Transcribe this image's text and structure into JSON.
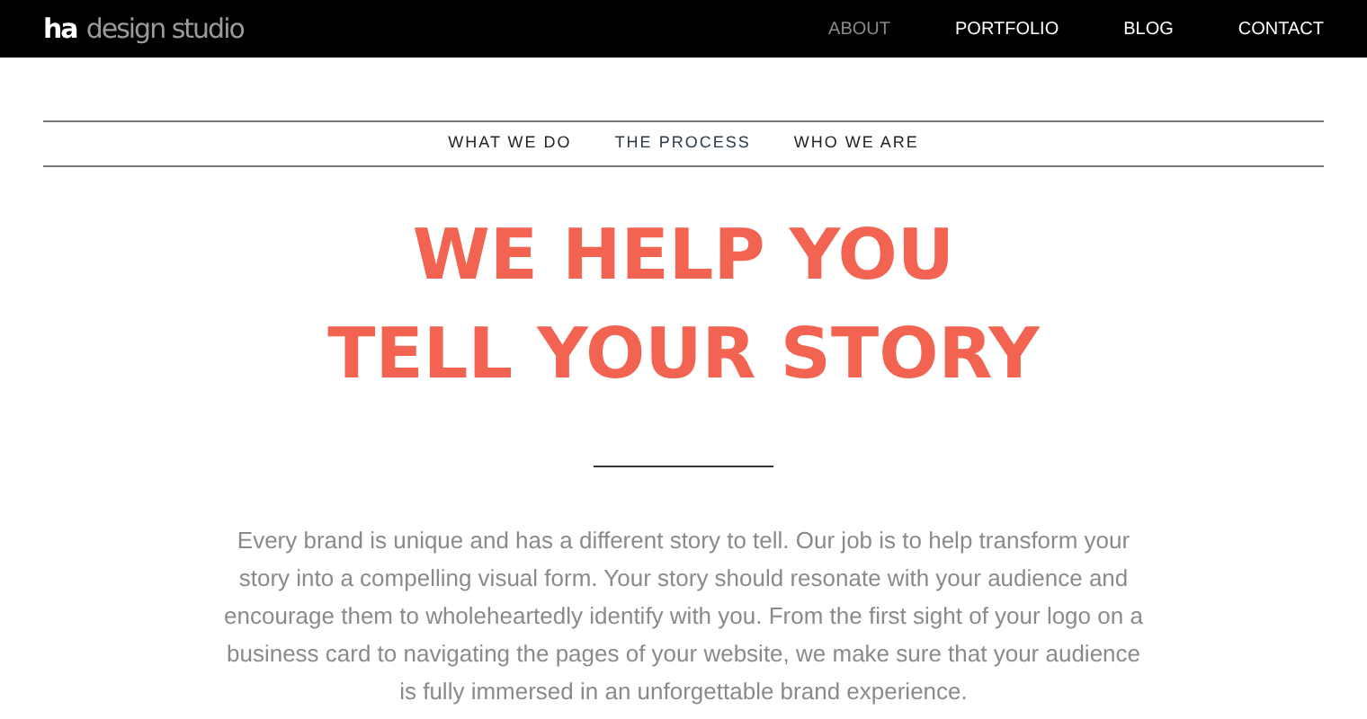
{
  "header": {
    "logo_mark": "ha",
    "logo_text": "design studio",
    "nav": [
      {
        "label": "ABOUT",
        "selected": true
      },
      {
        "label": "PORTFOLIO",
        "selected": false
      },
      {
        "label": "BLOG",
        "selected": false
      },
      {
        "label": "CONTACT",
        "selected": false
      }
    ]
  },
  "subnav": [
    {
      "label": "WHAT WE DO",
      "selected": false
    },
    {
      "label": "THE PROCESS",
      "selected": true
    },
    {
      "label": "WHO WE ARE",
      "selected": false
    }
  ],
  "hero": {
    "heading_lines": [
      "WE HELP YOU",
      "TELL YOUR STORY"
    ],
    "paragraph": "Every brand is unique and has a different story to tell. Our job is to help transform your story into a compelling visual form. Your story should resonate with your audience and encourage them to wholeheartedly identify with you. From the first sight of your logo on a business card to navigating the pages of your website, we make sure that your audience is fully immersed in an unforgettable brand experience."
  }
}
